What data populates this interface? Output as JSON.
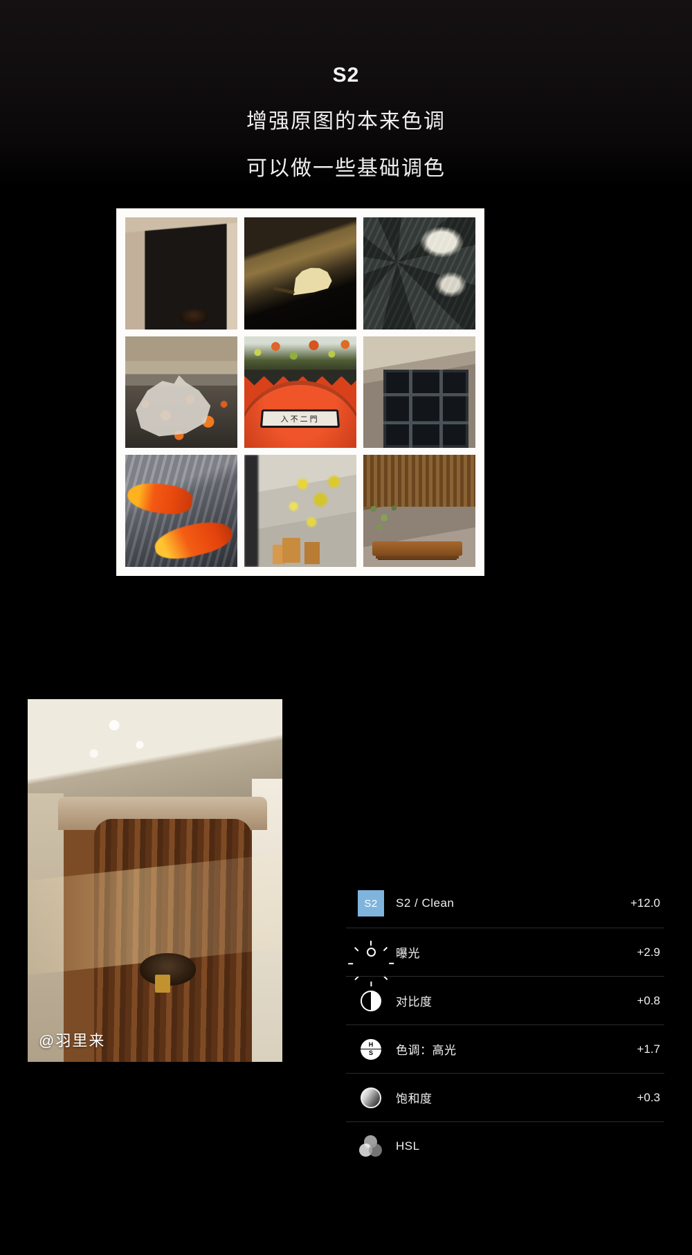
{
  "header": {
    "title": "S2",
    "subtitle_line1": "增强原图的本来色调",
    "subtitle_line2": "可以做一些基础调色"
  },
  "gallery": {
    "photos": [
      {
        "name": "wooden-door-stone-arch"
      },
      {
        "name": "ginkgo-leaf-on-ground"
      },
      {
        "name": "stone-wall-with-snow"
      },
      {
        "name": "crane-stone-carving"
      },
      {
        "name": "red-arch-gate-plaque",
        "plaque_text": "入不二門"
      },
      {
        "name": "dark-window-stone-wall"
      },
      {
        "name": "koi-fish-in-water"
      },
      {
        "name": "alley-with-stools"
      },
      {
        "name": "wooden-bench-courtyard"
      }
    ]
  },
  "hero": {
    "photo_name": "wooden-door-with-lock",
    "watermark": "@羽里来"
  },
  "adjustments": {
    "rows": [
      {
        "icon": "s2-preset-badge",
        "badge_text": "S2",
        "label": "S2 / Clean",
        "value": "+12.0"
      },
      {
        "icon": "sun-icon",
        "label": "曝光",
        "value": "+2.9"
      },
      {
        "icon": "contrast-icon",
        "label": "对比度",
        "value": "+0.8"
      },
      {
        "icon": "tone-hs-icon",
        "label": "色调：高光",
        "value": "+1.7"
      },
      {
        "icon": "saturation-icon",
        "label": "饱和度",
        "value": "+0.3"
      },
      {
        "icon": "hsl-icon",
        "label": "HSL",
        "value": ""
      }
    ]
  },
  "colors": {
    "background": "#000000",
    "badge_blue": "#7fb4dd",
    "text_primary": "#f1f1f1",
    "divider": "#2b2b2b",
    "card_white": "#fdfcfa"
  }
}
